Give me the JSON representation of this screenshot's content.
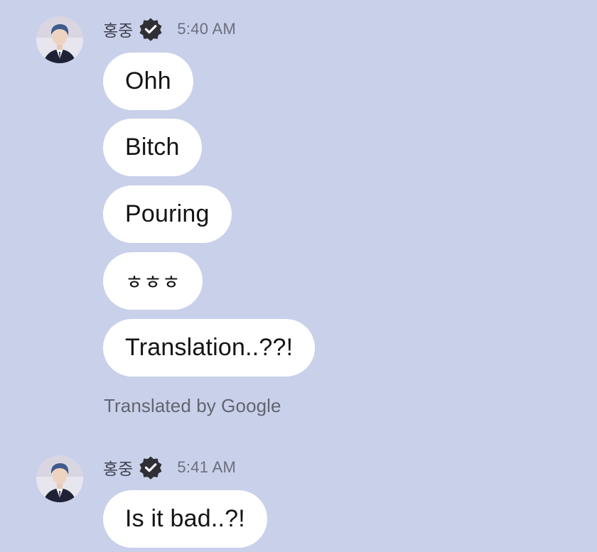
{
  "colors": {
    "background": "#c9d0ea",
    "bubble": "#ffffff",
    "text": "#141414",
    "meta_text": "#6b6e7e",
    "verified_badge": "#2f2f35"
  },
  "message_groups": [
    {
      "sender": "홍중",
      "verified_icon": "verified-badge-icon",
      "avatar_icon": "profile-photo",
      "time": "5:40 AM",
      "bubbles": [
        "Ohh",
        "Bitch",
        "Pouring",
        "ㅎㅎㅎ",
        "Translation..??!"
      ],
      "translation_note": "Translated by Google"
    },
    {
      "sender": "홍중",
      "verified_icon": "verified-badge-icon",
      "avatar_icon": "profile-photo",
      "time": "5:41 AM",
      "bubbles": [
        "Is it bad..?!"
      ]
    }
  ]
}
